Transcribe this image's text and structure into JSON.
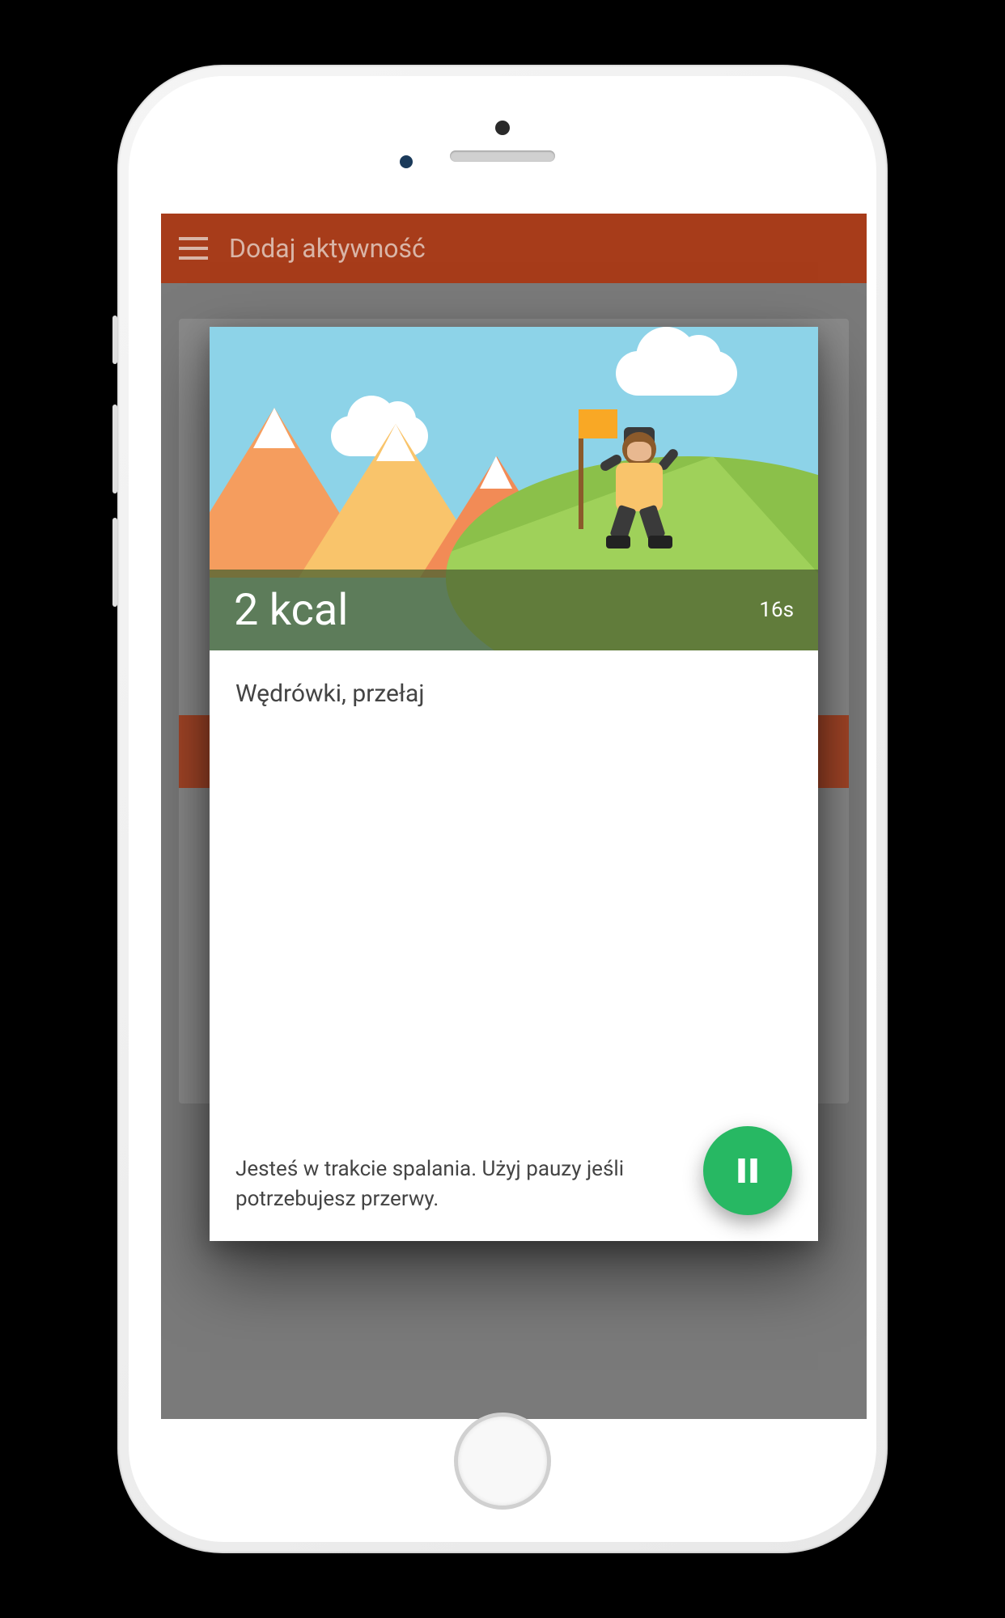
{
  "header": {
    "title": "Dodaj aktywność"
  },
  "dialog": {
    "calories_label": "2 kcal",
    "elapsed_time": "16s",
    "activity_name": "Wędrówki, przełaj",
    "hint_text": "Jesteś w trakcie spalania. Użyj pauzy jeśli potrzebujesz przerwy."
  }
}
